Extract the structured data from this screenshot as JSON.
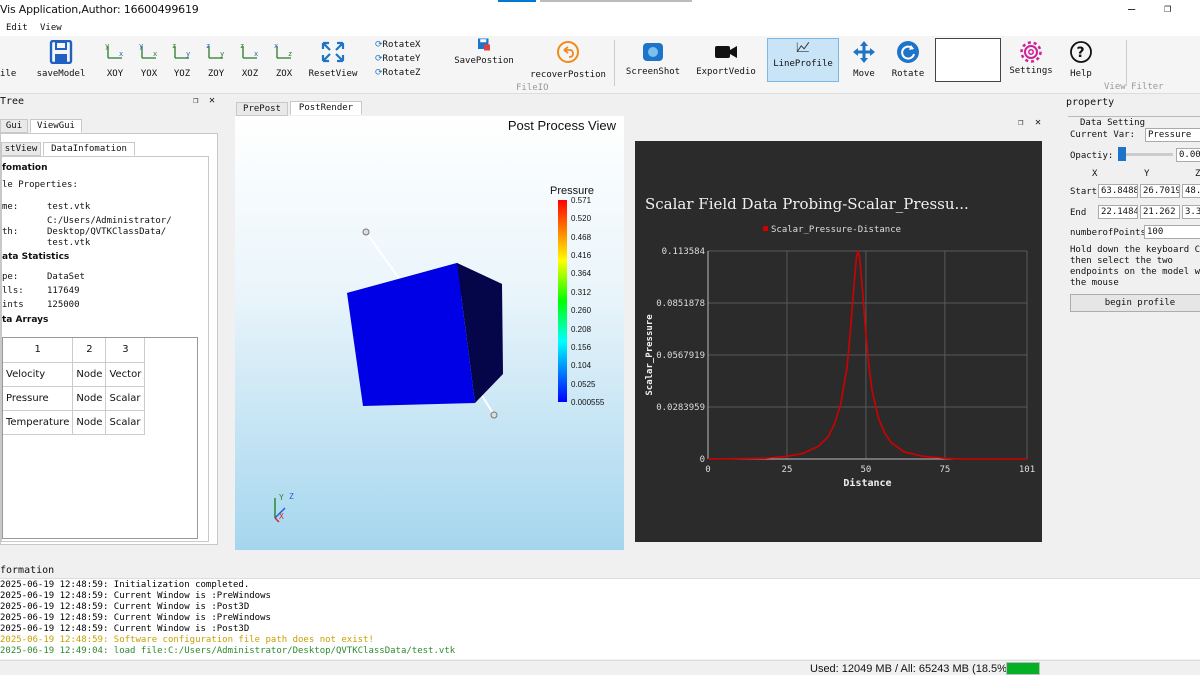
{
  "window": {
    "title": "Vis Application,Author: 16600499619"
  },
  "menu": [
    "Edit",
    "View"
  ],
  "toolbar": {
    "file": "ile",
    "save_model": "saveModel",
    "xoy": "XOY",
    "yox": "YOX",
    "yoz": "YOZ",
    "zoy": "ZOY",
    "xoz": "XOZ",
    "zox": "ZOX",
    "reset_view": "ResetView",
    "rotate_x": "RotateX",
    "rotate_y": "RotateY",
    "rotate_z": "RotateZ",
    "save_position": "SavePostion",
    "recover_position": "recoverPostion",
    "fileio_group": "FileIO",
    "screenshot": "ScreenShot",
    "export_video": "ExportVedio",
    "line_profile": "LineProfile",
    "move": "Move",
    "rotate": "Rotate",
    "settings": "Settings",
    "help": "Help",
    "view_filter": "View Filter",
    "accent": "#c9e4f7"
  },
  "left": {
    "title": "Tree",
    "tabs": [
      "Gui",
      "ViewGui"
    ],
    "subtabs": [
      "stView",
      "DataInfomation"
    ],
    "info_header": "fomation",
    "file_props": "le Properties:",
    "name_key": "me:",
    "name_val": "test.vtk",
    "path_key": "th:",
    "path_lines": [
      "C:/Users/Administrator/",
      "Desktop/QVTKClassData/",
      "test.vtk"
    ],
    "stats_header": "ata Statistics",
    "type_key": "pe:",
    "type_val": "DataSet",
    "cells_key": "lls:",
    "cells_val": "117649",
    "points_key": "ints",
    "points_val": "125000",
    "arrays_header": "ta Arrays",
    "table": {
      "headers": [
        "1",
        "2",
        "3"
      ],
      "rows": [
        [
          "Velocity",
          "Node",
          "Vector"
        ],
        [
          "Pressure",
          "Node",
          "Scalar"
        ],
        [
          "Temperature",
          "Node",
          "Scalar"
        ]
      ]
    }
  },
  "center": {
    "tabs": [
      "PrePost",
      "PostRender"
    ],
    "view_title": "Post Process View",
    "legend_title": "Pressure",
    "legend_values": [
      "0.571",
      "0.520",
      "0.468",
      "0.416",
      "0.364",
      "0.312",
      "0.260",
      "0.208",
      "0.156",
      "0.104",
      "0.0525",
      "0.000555"
    ],
    "axis_x": "X",
    "axis_y": "Y",
    "axis_z": "Z"
  },
  "chart_panel": {
    "chart_data": {
      "type": "line",
      "title": "Scalar Field Data Probing-Scalar_Pressu...",
      "xlabel": "Distance",
      "ylabel": "Scalar_Pressure",
      "legend": "top-center",
      "series": [
        {
          "name": "Scalar_Pressure-Distance",
          "color": "#d10000",
          "x": [
            0,
            18,
            25,
            30,
            35,
            38,
            40,
            42,
            44,
            45,
            46,
            47,
            47.5,
            48,
            49,
            50,
            51,
            52,
            54,
            56,
            58,
            62,
            68,
            75,
            80,
            90,
            101
          ],
          "y": [
            0,
            0.0004,
            0.0015,
            0.003,
            0.007,
            0.012,
            0.019,
            0.03,
            0.05,
            0.068,
            0.09,
            0.11,
            0.1136,
            0.11,
            0.09,
            0.068,
            0.05,
            0.037,
            0.022,
            0.014,
            0.009,
            0.004,
            0.0015,
            0.0004,
            0,
            0,
            0
          ]
        }
      ],
      "x_ticks": [
        "0",
        "25",
        "50",
        "75",
        "101"
      ],
      "y_ticks": [
        "0",
        "0.0283959",
        "0.0567919",
        "0.0851878",
        "0.113584"
      ],
      "xlim": [
        0,
        101
      ],
      "ylim": [
        0,
        0.113584
      ],
      "grid": true
    }
  },
  "right": {
    "title": "property",
    "group": "Data Setting",
    "current_var_label": "Current Var:",
    "current_var_value": "Pressure",
    "opacity_label": "Opactiy:",
    "opacity_value": "0.00",
    "col_x": "X",
    "col_y": "Y",
    "col_z": "Z",
    "start_label": "Start",
    "start_x": "63.8488",
    "start_y": "26.7019",
    "start_z": "48.",
    "end_label": "End",
    "end_x": "22.1484",
    "end_y": "21.262",
    "end_z": "3.3",
    "points_label": "numberofPoints:",
    "points_value": "100",
    "hint_lines": [
      "Hold down the keyboard Ct",
      "then select the two",
      "endpoints on the model wi",
      "the mouse"
    ],
    "begin_button": "begin profile"
  },
  "log": {
    "title": "formation",
    "lines": [
      {
        "text": "2025-06-19 12:48:59: Initialization completed.",
        "color": "#000000"
      },
      {
        "text": "2025-06-19 12:48:59: Current Window is :PreWindows",
        "color": "#000000"
      },
      {
        "text": "2025-06-19 12:48:59: Current Window is :Post3D",
        "color": "#000000"
      },
      {
        "text": "2025-06-19 12:48:59: Current Window is :PreWindows",
        "color": "#000000"
      },
      {
        "text": "2025-06-19 12:48:59: Current Window is :Post3D",
        "color": "#000000"
      },
      {
        "text": "2025-06-19 12:48:59: Software configuration file path does not exist!",
        "color": "#c8a000"
      },
      {
        "text": "2025-06-19 12:49:04: load file:C:/Users/Administrator/Desktop/QVTKClassData/test.vtk",
        "color": "#2e8b2e"
      }
    ]
  },
  "status": {
    "memory": "Used: 12049 MB / All: 65243 MB (18.5%)",
    "memory_fraction": 0.185,
    "bar_color": "#06b025"
  }
}
